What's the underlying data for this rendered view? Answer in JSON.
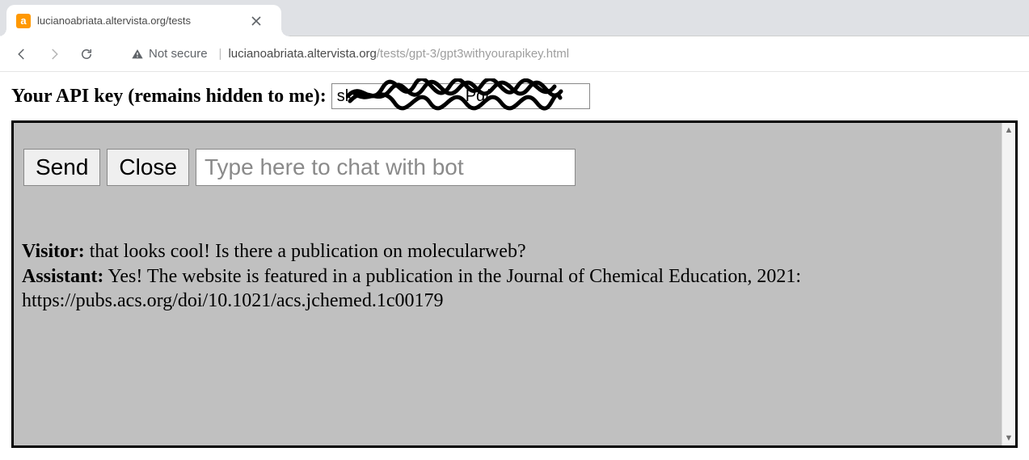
{
  "browser": {
    "tab_title": "lucianoabriata.altervista.org/tests",
    "favicon_letter": "a",
    "security_label": "Not secure",
    "url_host": "lucianoabriata.altervista.org",
    "url_path": "/tests/gpt-3/gpt3withyourapikey.html"
  },
  "page": {
    "apikey_label": "Your API key (remains hidden to me):",
    "apikey_value_visible_prefix": "sk",
    "apikey_value_visible_suffix": "Pq/",
    "send_label": "Send",
    "close_label": "Close",
    "chat_placeholder": "Type here to chat with bot",
    "transcript": {
      "visitor_role": "Visitor:",
      "visitor_text": " that looks cool! Is there a publication on molecularweb?",
      "assistant_role": "Assistant:",
      "assistant_text": " Yes! The website is featured in a publication in the Journal of Chemical Education, 2021: https://pubs.acs.org/doi/10.1021/acs.jchemed.1c00179"
    }
  }
}
